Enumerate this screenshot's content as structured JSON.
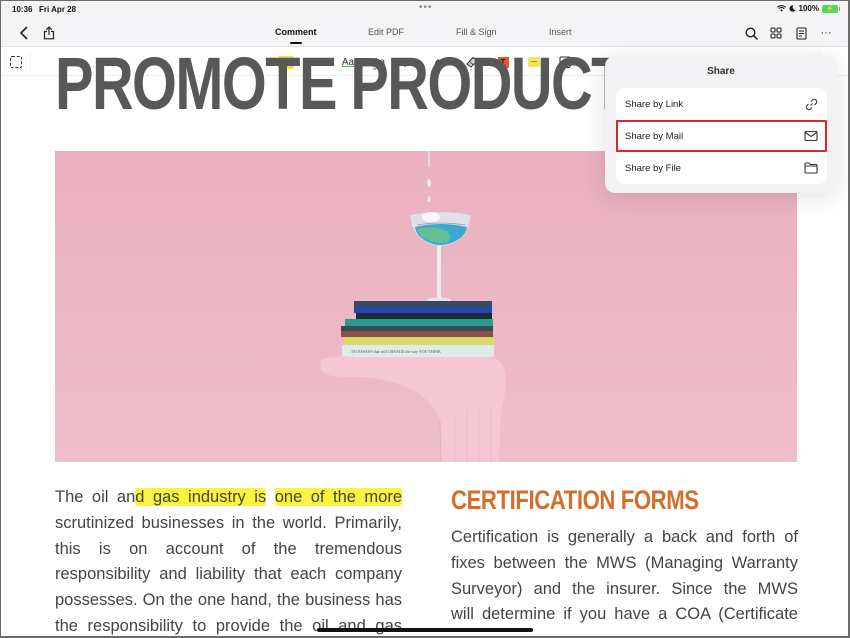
{
  "status_bar": {
    "time": "10:36",
    "date": "Fri Apr 28",
    "battery": "100%",
    "icons": [
      "wifi-icon",
      "moon-icon",
      "battery-charging-icon"
    ],
    "more_dots": "•••"
  },
  "nav": {
    "back_icon": "chevron-left-icon",
    "share_icon": "share-icon",
    "tabs": [
      {
        "label": "Comment",
        "active": true
      },
      {
        "label": "Edit PDF",
        "active": false
      },
      {
        "label": "Fill & Sign",
        "active": false
      },
      {
        "label": "Insert",
        "active": false
      }
    ],
    "right_icons": [
      "search-icon",
      "grid-icon",
      "page-view-icon",
      "more-icon"
    ],
    "more_label": "···"
  },
  "toolbar": {
    "tools": [
      {
        "name": "area-select",
        "icon": "dashed-rect-icon"
      },
      {
        "name": "highlight",
        "label": "Aa",
        "color": "#f7e23b"
      },
      {
        "name": "strikethrough",
        "label": "Aa",
        "color": "#d33333"
      },
      {
        "name": "underline",
        "label": "Aa",
        "color": "#5cb85c"
      },
      {
        "name": "squiggly",
        "label": "Aa",
        "color": "#4a7bd6"
      },
      {
        "name": "pen",
        "icon": "pen-icon"
      },
      {
        "name": "marker",
        "icon": "marker-icon"
      },
      {
        "name": "eraser",
        "icon": "eraser-icon"
      },
      {
        "name": "text-box",
        "label": "T",
        "color": "#e4552c"
      },
      {
        "name": "sticky-note",
        "icon": "note-icon",
        "color": "#f5e45a"
      },
      {
        "name": "shape",
        "icon": "shape-icon"
      }
    ]
  },
  "document": {
    "title": "PROMOTE PRODUCT",
    "image_alt": "Cocktail glass balanced on a stack of books held by a pink-socked foot against a pink background",
    "image_bg": "#eeb9c7",
    "left_column": {
      "highlights_color": "#fbf33d",
      "lines": [
        {
          "pre": "The oil an",
          "hl1": "d gas industry is",
          "mid": " ",
          "hl2": "one of the more"
        },
        {
          "text": "scrutinized businesses in the world. Primarily,"
        },
        {
          "text": "this is on account of the tremendous"
        },
        {
          "text": "responsibility and liability that each company"
        },
        {
          "text": "possesses. On the one hand, the business has"
        },
        {
          "text": "the responsibility to provide the oil and gas"
        }
      ]
    },
    "right_column": {
      "heading": "CERTIFICATION FORMS",
      "heading_color": "#d36f2b",
      "lines": [
        "Certification is generally a back and forth of",
        "fixes between the MWS (Managing Warranty",
        "Surveyor) and the insurer. Since the MWS",
        "will determine if you have a COA (Certificate"
      ]
    }
  },
  "share_popover": {
    "title": "Share",
    "items": [
      {
        "label": "Share by Link",
        "icon": "link-icon",
        "selected": false
      },
      {
        "label": "Share by Mail",
        "icon": "mail-icon",
        "selected": true
      },
      {
        "label": "Share by File",
        "icon": "folder-icon",
        "selected": false
      }
    ],
    "selected_outline_color": "#d9262c"
  }
}
